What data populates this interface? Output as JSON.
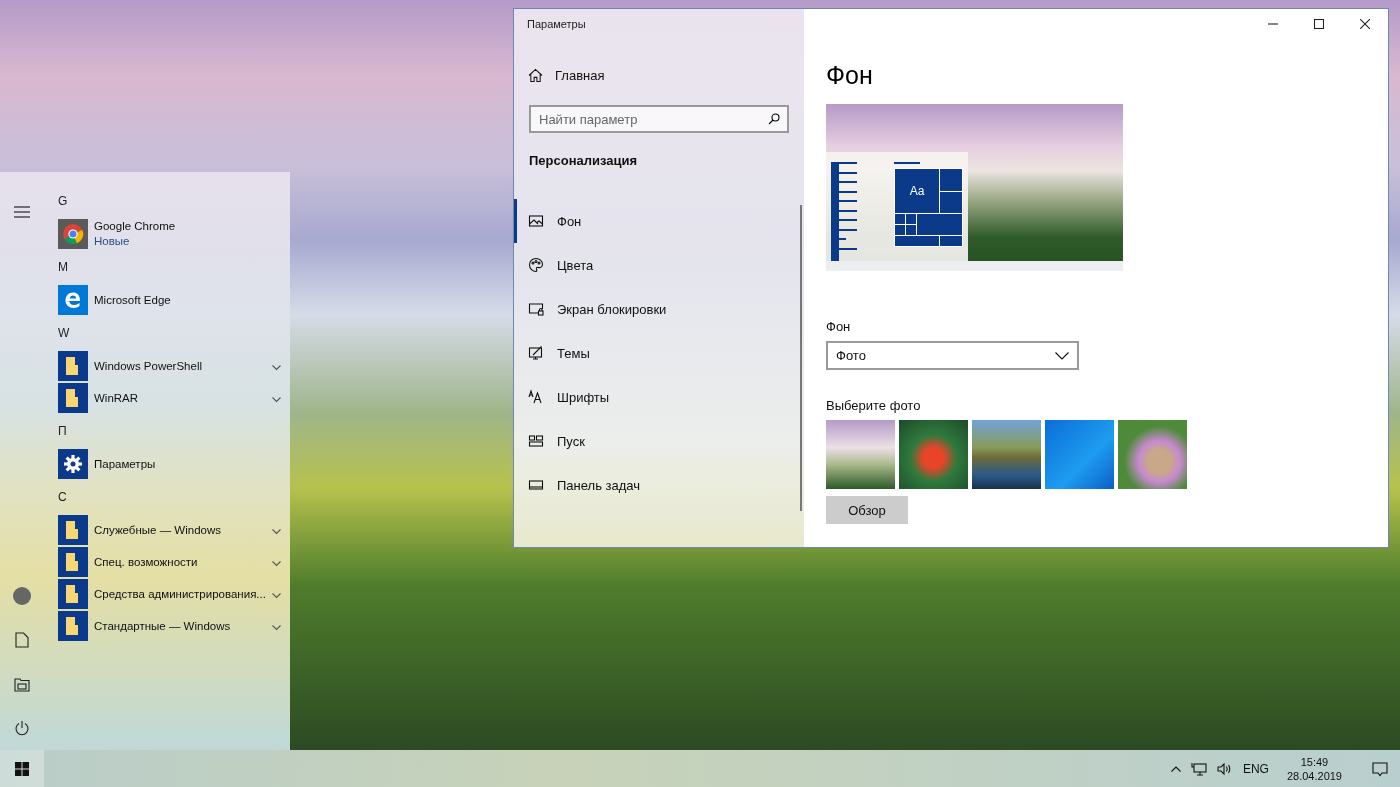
{
  "start_menu": {
    "groups": [
      {
        "letter": "G",
        "apps": [
          {
            "name": "Google Chrome",
            "subtitle": "Новые",
            "kind": "chrome",
            "expandable": false
          }
        ]
      },
      {
        "letter": "M",
        "apps": [
          {
            "name": "Microsoft Edge",
            "kind": "edge",
            "expandable": false
          }
        ]
      },
      {
        "letter": "W",
        "apps": [
          {
            "name": "Windows PowerShell",
            "kind": "folder",
            "expandable": true
          },
          {
            "name": "WinRAR",
            "kind": "folder",
            "expandable": true
          }
        ]
      },
      {
        "letter": "П",
        "apps": [
          {
            "name": "Параметры",
            "kind": "gear",
            "expandable": false
          }
        ]
      },
      {
        "letter": "C",
        "apps": [
          {
            "name": "Служебные — Windows",
            "kind": "folder",
            "expandable": true
          },
          {
            "name": "Спец. возможности",
            "kind": "folder",
            "expandable": true
          },
          {
            "name": "Средства администрирования...",
            "kind": "folder",
            "expandable": true
          },
          {
            "name": "Стандартные — Windows",
            "kind": "folder",
            "expandable": true
          }
        ]
      }
    ]
  },
  "settings_window": {
    "title": "Параметры",
    "home": "Главная",
    "search": {
      "placeholder": "Найти параметр"
    },
    "section": "Персонализация",
    "nav": [
      {
        "label": "Фон",
        "kind": "picture",
        "selected": true
      },
      {
        "label": "Цвета",
        "kind": "palette",
        "selected": false
      },
      {
        "label": "Экран блокировки",
        "kind": "lock-screen",
        "selected": false
      },
      {
        "label": "Темы",
        "kind": "theme",
        "selected": false
      },
      {
        "label": "Шрифты",
        "kind": "fonts",
        "selected": false
      },
      {
        "label": "Пуск",
        "kind": "start",
        "selected": false
      },
      {
        "label": "Панель задач",
        "kind": "taskbar",
        "selected": false
      }
    ],
    "page_title": "Фон",
    "preview_tile_text": "Aa",
    "background_label": "Фон",
    "background_dropdown": {
      "value": "Фото"
    },
    "choose_label": "Выберите фото",
    "browse_button": "Обзор"
  },
  "taskbar": {
    "language": "ENG",
    "time": "15:49",
    "date": "28.04.2019"
  }
}
